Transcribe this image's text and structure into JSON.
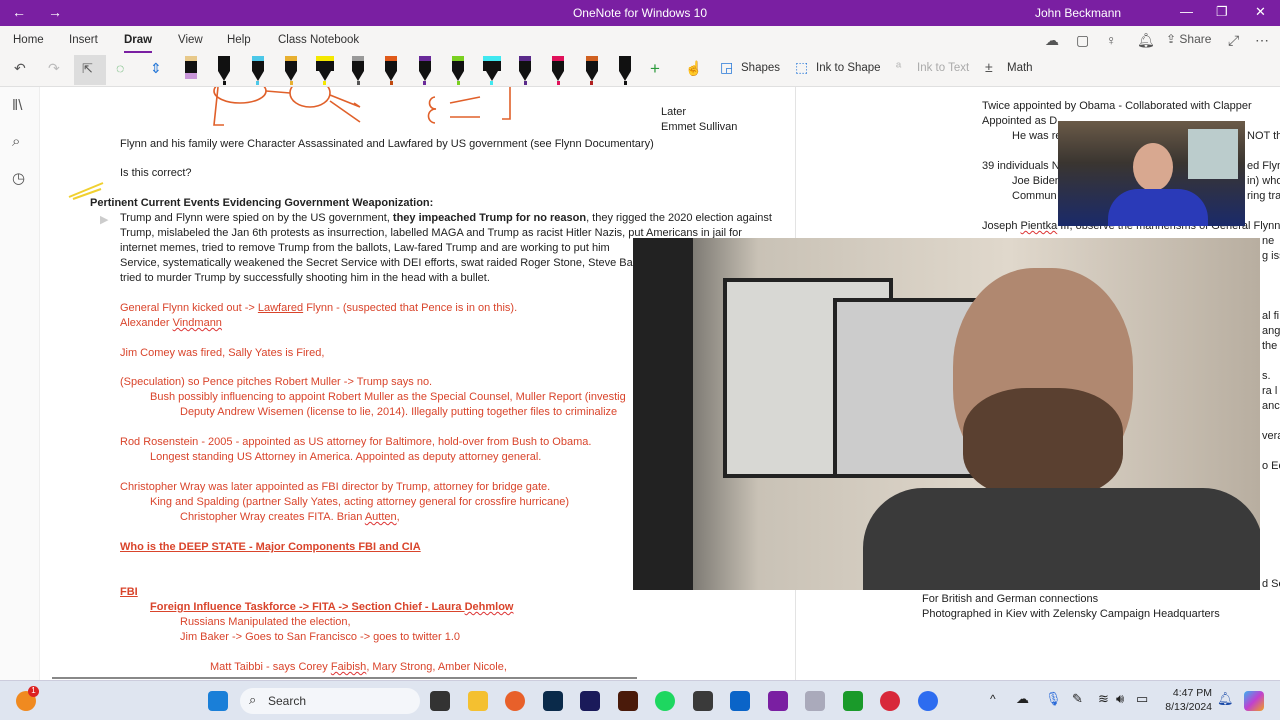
{
  "titlebar": {
    "title": "OneNote for Windows 10",
    "user": "John Beckmann",
    "back": "←",
    "forward": "→",
    "minimize": "—",
    "maximize": "❐",
    "close": "✕"
  },
  "ribbon": {
    "tabs": [
      "Home",
      "Insert",
      "Draw",
      "View",
      "Help",
      "Class Notebook"
    ],
    "active_tab": "Draw",
    "pens": [
      {
        "cap": "#e8c98a",
        "body": "#c896d8",
        "type": "eraser"
      },
      {
        "cap": "#111",
        "tip": "#111"
      },
      {
        "cap": "#4cc8e8",
        "tip": "#4cc8e8"
      },
      {
        "cap": "#e8b030",
        "tip": "#e8b030"
      },
      {
        "cap": "#f4e800",
        "tip": "#f4e800",
        "type": "highlighter"
      },
      {
        "cap": "#999",
        "tip": "#555"
      },
      {
        "cap": "#e05a1a",
        "tip": "#c04a10"
      },
      {
        "cap": "#6a2a9a",
        "tip": "#6a2a9a"
      },
      {
        "cap": "#7ad020",
        "tip": "#7ad020"
      },
      {
        "cap": "#40e8f0",
        "tip": "#40e8f0",
        "type": "highlighter"
      },
      {
        "cap": "#5a2a8a",
        "tip": "#5a2a8a"
      },
      {
        "cap": "#e0105a",
        "tip": "#e0105a"
      },
      {
        "cap": "#d06020",
        "tip": "#b02020"
      },
      {
        "cap": "#111",
        "tip": "#111"
      }
    ],
    "tools": {
      "shapes": "Shapes",
      "ink_to_shape": "Ink to Shape",
      "ink_to_text": "Ink to Text",
      "math": "Math",
      "share": "Share"
    }
  },
  "page": {
    "later": "Later",
    "emmet": "Emmet Sullivan",
    "flynn_family": "Flynn and his family were Character Assassinated and Lawfared by US government (see Flynn Documentary)",
    "is_correct": "Is this correct?",
    "heading": "Pertinent Current Events Evidencing Government Weaponization:",
    "p1a": "Trump and Flynn were spied on by the US government, ",
    "p1b": "they impeached Trump for no reason",
    "p1c": ", they rigged the 2020 election against",
    "p2": "Trump, mislabeled the Jan 6th protests as insurrection, labelled MAGA and Trump as racist Hitler Nazis, put Americans in jail for",
    "p3": "internet memes, tried to remove Trump from the ballots, Law-fared Trump and are working to put him",
    "p4": "Service, systematically weakened the Secret Service with DEI efforts, swat raided Roger  Stone, Steve Ba",
    "p5": "tried to murder Trump by successfully shooting him in the head with a bullet.",
    "r1a": "General Flynn kicked out -> ",
    "r1b": "Lawfared",
    "r1c": " Flynn - (suspected that Pence is in on this).",
    "r2a": "Alexander ",
    "r2b": "Vindmann",
    "r3": "Jim Comey was fired, Sally Yates is Fired,",
    "r4": "(Speculation) so Pence pitches Robert Muller -> Trump says no.",
    "r5": "Bush possibly influencing to appoint Robert Muller as the Special Counsel, Muller Report (investig",
    "r6": "Deputy Andrew Wisemen (license to lie, 2014). Illegally putting together files to criminalize",
    "r7": "Rod Rosenstein - 2005 - appointed as US attorney for Baltimore, hold-over from Bush to Obama.",
    "r8": "Longest standing US Attorney in America. Appointed as deputy attorney general.",
    "r9": "Christopher Wray was later appointed as FBI director by Trump, attorney for bridge gate.",
    "r10": "King and Spalding (partner Sally Yates, acting attorney general for crossfire hurricane)",
    "r11a": "Christopher Wray creates FITA. Brian ",
    "r11b": "Autten",
    "r12": "Who is the DEEP STATE - Major Components FBI and CIA",
    "r13": "FBI",
    "r14a": "Foreign Influence Taskforce ->  FITA -> Section Chief - Laura ",
    "r14b": "Dehmlow",
    "r15": "Russians Manipulated the election,",
    "r16": "Jim Baker -> Goes to San Francisco -> goes to twitter 1.0",
    "r17a": "Matt Taibbi - says Corey ",
    "r17b": "Faibish",
    "r17c": ", Mary Strong, Amber Nicole,",
    "right": {
      "l1": "Twice appointed by Obama - Collaborated with Clapper",
      "l2": "Appointed as D",
      "l3": "He was re",
      "l3b": "NOT th",
      "l4": "39 individuals N",
      "l4b": "ed Flyn",
      "l5": "Joe Biden",
      "l5b": "in) who",
      "l6": "Commun",
      "l6b": "ring tra",
      "l7a": "Joseph ",
      "l7b": "Pientka",
      "l7c": " III, observe the mannerisms of General Flynn",
      "l8": "ne",
      "frag": [
        "g iss",
        "al fi",
        "ang",
        "the",
        "s.",
        "ra l",
        "anc",
        "vera",
        "o Ec",
        "d Se"
      ],
      "l9": "For British and German connections",
      "l10": "Photographed in Kiev with Zelensky Campaign Headquarters"
    }
  },
  "taskbar": {
    "search": "Search",
    "time": "4:47 PM",
    "date": "8/13/2024",
    "badge": "1",
    "apps": [
      {
        "name": "windows-start",
        "color": "#1a7fd8"
      },
      {
        "name": "task-view",
        "color": "#333"
      },
      {
        "name": "file-explorer",
        "color": "#f4c030"
      },
      {
        "name": "firefox",
        "color": "#e8602a"
      },
      {
        "name": "photoshop",
        "color": "#0a2a4a"
      },
      {
        "name": "premiere",
        "color": "#1a1a5a"
      },
      {
        "name": "illustrator",
        "color": "#4a1a0a"
      },
      {
        "name": "spotify",
        "color": "#1ed760"
      },
      {
        "name": "sublime",
        "color": "#3a3a3a"
      },
      {
        "name": "outlook",
        "color": "#0a64c8"
      },
      {
        "name": "onenote",
        "color": "#7a1fa2"
      },
      {
        "name": "app-gray",
        "color": "#aab"
      },
      {
        "name": "xbox",
        "color": "#1a9a2a"
      },
      {
        "name": "expressvpn",
        "color": "#d8283a"
      },
      {
        "name": "zoom",
        "color": "#2d6cf0"
      }
    ]
  }
}
